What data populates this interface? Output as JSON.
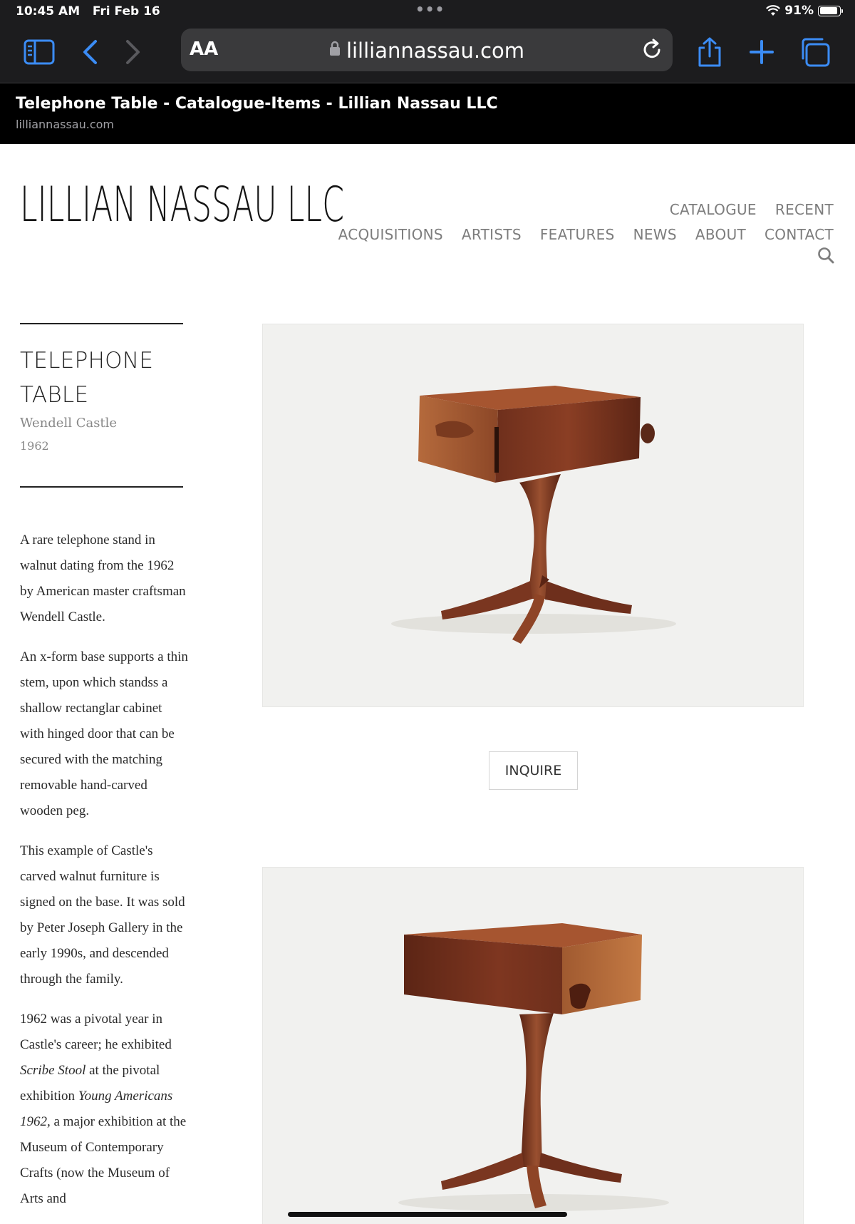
{
  "status": {
    "time": "10:45 AM",
    "date": "Fri Feb 16",
    "battery": "91%",
    "battery_fraction": 0.91,
    "dots": "•••"
  },
  "browser": {
    "aa_label": "AA",
    "host": "lilliannassau.com"
  },
  "tab": {
    "title": "Telephone Table - Catalogue-Items - Lillian Nassau LLC",
    "subtitle": "lilliannassau.com"
  },
  "site": {
    "logo": "LILLIAN NASSAU LLC",
    "nav_row1": [
      "CATALOGUE",
      "RECENT"
    ],
    "nav_row2": [
      "ACQUISITIONS",
      "ARTISTS",
      "FEATURES",
      "NEWS",
      "ABOUT",
      "CONTACT"
    ]
  },
  "item": {
    "title_line1": "TELEPHONE",
    "title_line2": "TABLE",
    "artist": "Wendell Castle",
    "year": "1962",
    "inquire_label": "INQUIRE",
    "description": {
      "p1": "A rare telephone stand in walnut dating from the 1962 by American master craftsman Wendell Castle.",
      "p2": "An x-form base supports a thin stem, upon which standss a shallow rectanglar cabinet with hinged door that can be secured with the matching removable hand-carved wooden peg.",
      "p3": "This example of Castle's carved walnut furniture is signed on the base. It was sold by Peter Joseph Gallery in the early 1990s, and descended through the family.",
      "p4_a": "1962 was a pivotal year in Castle's career; he exhibited ",
      "p4_em1": "Scribe Stool",
      "p4_b": " at the pivotal exhibition ",
      "p4_em2": "Young Americans 1962,",
      "p4_c": " a major exhibition at the Museum of Contemporary Crafts (now the Museum of Arts and"
    }
  }
}
